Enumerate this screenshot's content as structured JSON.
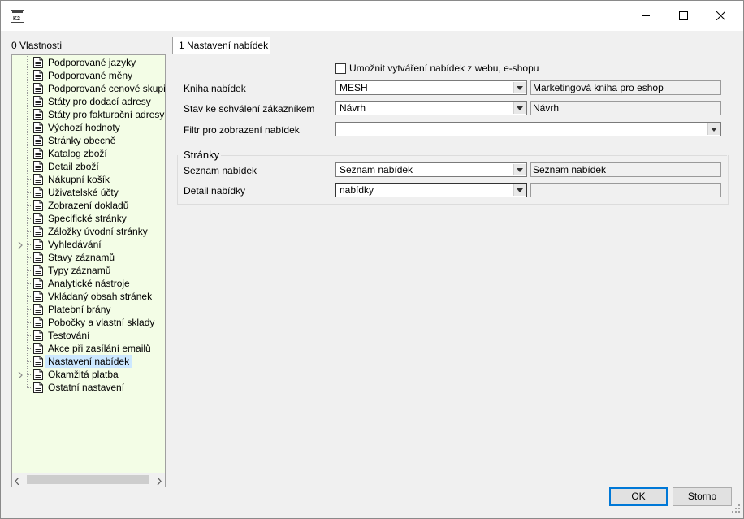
{
  "window": {
    "app_icon": "k2-app-icon",
    "minimize_icon": "minimize-icon",
    "maximize_icon": "maximize-icon",
    "close_icon": "close-icon"
  },
  "sidebar": {
    "title_underline": "0",
    "title": " Vlastnosti",
    "items": [
      {
        "label": "Podporované jazyky",
        "expandable": false
      },
      {
        "label": "Podporované měny",
        "expandable": false
      },
      {
        "label": "Podporované cenové skupiny",
        "expandable": false
      },
      {
        "label": "Státy pro dodací adresy",
        "expandable": false
      },
      {
        "label": "Státy pro fakturační adresy",
        "expandable": false
      },
      {
        "label": "Výchozí hodnoty",
        "expandable": false
      },
      {
        "label": "Stránky obecně",
        "expandable": false
      },
      {
        "label": "Katalog zboží",
        "expandable": false
      },
      {
        "label": "Detail zboží",
        "expandable": false
      },
      {
        "label": "Nákupní košík",
        "expandable": false
      },
      {
        "label": "Uživatelské účty",
        "expandable": false
      },
      {
        "label": "Zobrazení dokladů",
        "expandable": false
      },
      {
        "label": "Specifické stránky",
        "expandable": false
      },
      {
        "label": "Záložky úvodní stránky",
        "expandable": false
      },
      {
        "label": "Vyhledávání",
        "expandable": true
      },
      {
        "label": "Stavy záznamů",
        "expandable": false
      },
      {
        "label": "Typy záznamů",
        "expandable": false
      },
      {
        "label": "Analytické nástroje",
        "expandable": false
      },
      {
        "label": "Vkládaný obsah stránek",
        "expandable": false
      },
      {
        "label": "Platební brány",
        "expandable": false
      },
      {
        "label": "Pobočky a vlastní sklady",
        "expandable": false
      },
      {
        "label": "Testování",
        "expandable": false
      },
      {
        "label": "Akce při zasílání emailů",
        "expandable": false
      },
      {
        "label": "Nastavení nabídek",
        "expandable": false,
        "selected": true
      },
      {
        "label": "Okamžitá platba",
        "expandable": true
      },
      {
        "label": "Ostatní nastavení",
        "expandable": false
      }
    ]
  },
  "tab": {
    "label": "1 Nastavení nabídek"
  },
  "form": {
    "allow_web_label": "Umožnit vytváření nabídek z webu, e-shopu",
    "allow_web_checked": false,
    "kniha_label": "Kniha nabídek",
    "kniha_value": "MESH",
    "kniha_desc": "Marketingová kniha pro eshop",
    "stav_label": "Stav ke schválení zákazníkem",
    "stav_value": "Návrh",
    "stav_desc": "Návrh",
    "filtr_label": "Filtr pro zobrazení nabídek",
    "filtr_value": ""
  },
  "pages_group": {
    "title": "Stránky",
    "seznam_label": "Seznam nabídek",
    "seznam_value": "Seznam nabídek",
    "seznam_desc": "Seznam nabídek",
    "detail_label": "Detail nabídky",
    "detail_value": "nabídky",
    "detail_desc": ""
  },
  "buttons": {
    "ok": "OK",
    "cancel": "Storno"
  }
}
